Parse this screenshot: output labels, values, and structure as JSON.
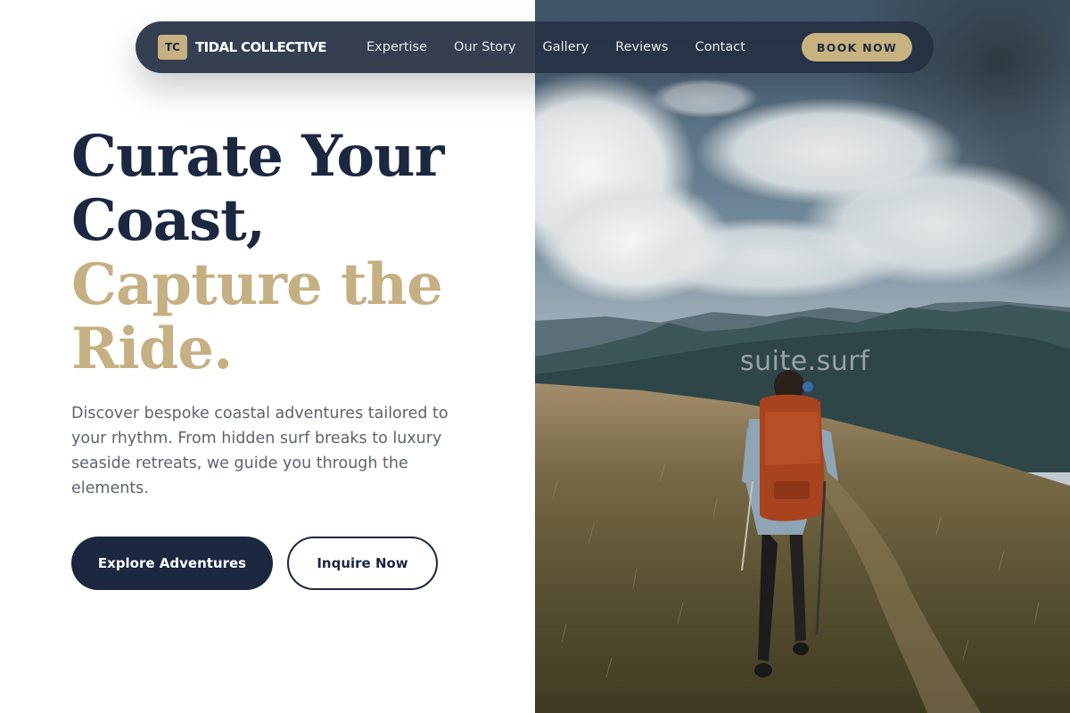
{
  "nav": {
    "logo_initials": "TC",
    "brand_name": "TIDAL COLLECTIVE",
    "links": [
      {
        "label": "Expertise"
      },
      {
        "label": "Our Story"
      },
      {
        "label": "Gallery"
      },
      {
        "label": "Reviews"
      },
      {
        "label": "Contact"
      }
    ],
    "cta_label": "BOOK NOW"
  },
  "hero": {
    "headline_line1": "Curate Your",
    "headline_line2": "Coast,",
    "headline_line3": "Capture the",
    "headline_line4": "Ride.",
    "description": "Discover bespoke coastal adventures tailored to your rhythm. From hidden surf breaks to luxury seaside retreats, we guide you through the elements.",
    "primary_button": "Explore Adventures",
    "secondary_button": "Inquire Now"
  },
  "photo": {
    "watermark": "suite.surf"
  },
  "colors": {
    "navy": "#1c2740",
    "gold": "#c5b083",
    "nav_background": "#263044",
    "body_text": "#5b6472"
  }
}
